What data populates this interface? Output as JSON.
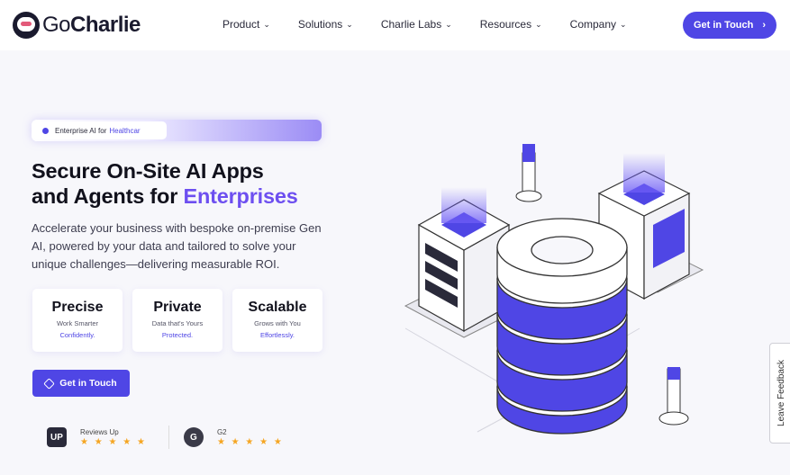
{
  "brand": {
    "name_light": "Go",
    "name_bold": "Charlie"
  },
  "nav": {
    "items": [
      {
        "label": "Product"
      },
      {
        "label": "Solutions"
      },
      {
        "label": "Charlie Labs"
      },
      {
        "label": "Resources"
      },
      {
        "label": "Company"
      }
    ],
    "cta_label": "Get in Touch",
    "cta_icon": "chevron-right-icon"
  },
  "hero": {
    "pill": {
      "text": "Enterprise AI for ",
      "highlight": "Healthcar"
    },
    "headline_line1": "Secure On-Site AI Apps",
    "headline_line2_plain": "and Agents for ",
    "headline_line2_accent": "Enterprises",
    "description": "Accelerate your business with bespoke on-premise Gen AI, powered by your data and tailored to solve your unique challenges—delivering measurable ROI.",
    "cards": [
      {
        "title": "Precise",
        "sub": "Work Smarter",
        "highlight": "Confidently."
      },
      {
        "title": "Private",
        "sub": "Data that's Yours",
        "highlight": "Protected."
      },
      {
        "title": "Scalable",
        "sub": "Grows with You",
        "highlight": "Effortlessly."
      }
    ],
    "cta_label": "Get in Touch"
  },
  "reviews": [
    {
      "logo_text": "UP",
      "name": "Reviews Up",
      "stars": "★ ★ ★ ★ ★"
    },
    {
      "logo_text": "G",
      "name": "G2",
      "stars": "★ ★ ★ ★ ★"
    }
  ],
  "feedback_label": "Leave Feedback",
  "colors": {
    "accent": "#4f46e5",
    "accent_light": "#6d4ff0",
    "star": "#f5a623"
  }
}
